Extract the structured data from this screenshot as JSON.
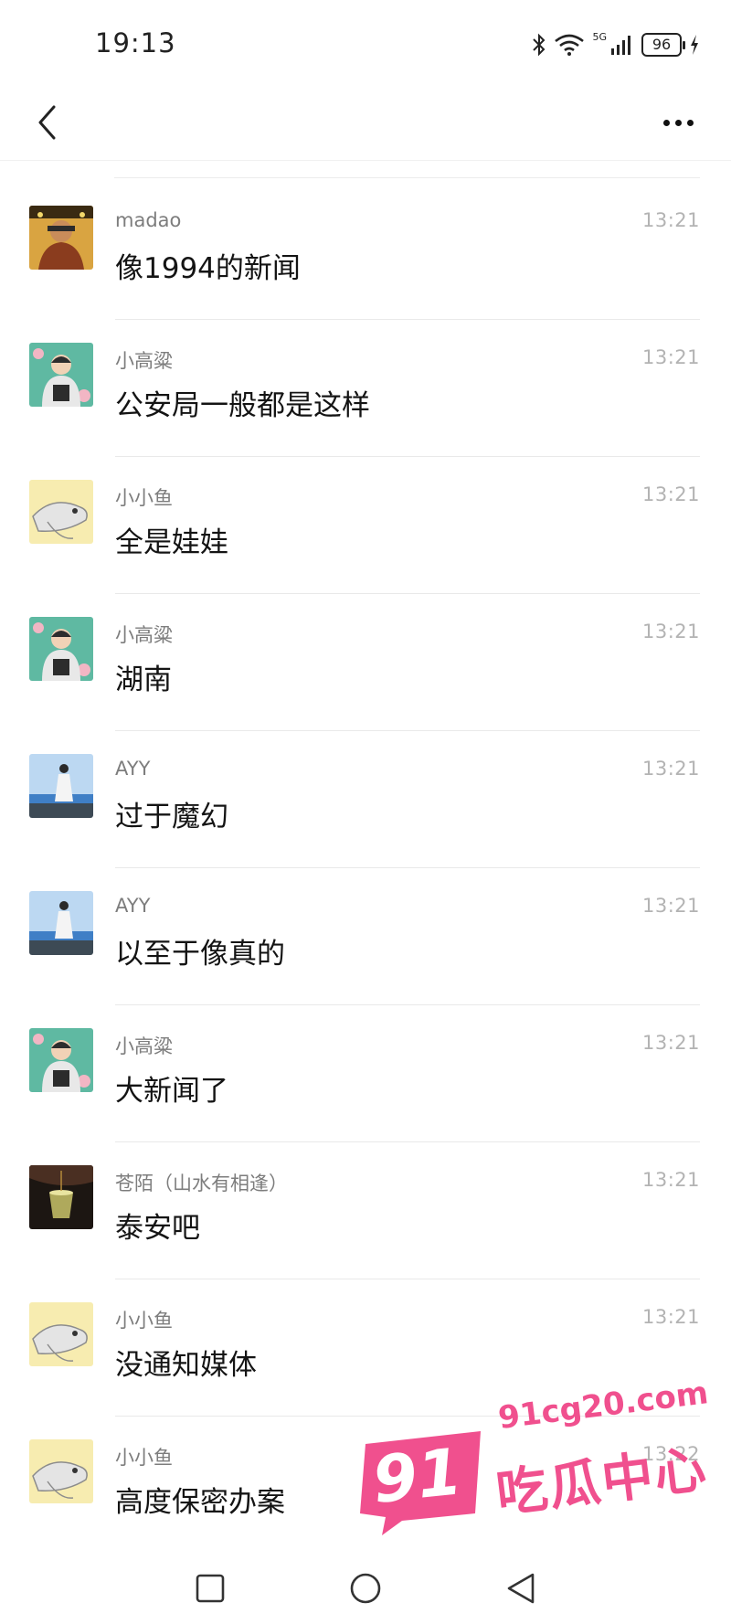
{
  "status": {
    "time": "19:13",
    "network": "5G",
    "battery": "96"
  },
  "messages": [
    {
      "sender": "madao",
      "time": "13:21",
      "text": "像1994的新闻",
      "avatar": "avatar-madao"
    },
    {
      "sender": "小高粱",
      "time": "13:21",
      "text": "公安局一般都是这样",
      "avatar": "avatar-xiaogaoliang"
    },
    {
      "sender": "小小鱼",
      "time": "13:21",
      "text": "全是娃娃",
      "avatar": "avatar-xiaoxiaoyu"
    },
    {
      "sender": "小高粱",
      "time": "13:21",
      "text": "湖南",
      "avatar": "avatar-xiaogaoliang"
    },
    {
      "sender": "AYY",
      "time": "13:21",
      "text": "过于魔幻",
      "avatar": "avatar-ayy"
    },
    {
      "sender": "AYY",
      "time": "13:21",
      "text": "以至于像真的",
      "avatar": "avatar-ayy"
    },
    {
      "sender": "小高粱",
      "time": "13:21",
      "text": "大新闻了",
      "avatar": "avatar-xiaogaoliang"
    },
    {
      "sender": "苍陌（山水有相逢）",
      "time": "13:21",
      "text": "泰安吧",
      "avatar": "avatar-cangmo"
    },
    {
      "sender": "小小鱼",
      "time": "13:21",
      "text": "没通知媒体",
      "avatar": "avatar-xiaoxiaoyu"
    },
    {
      "sender": "小小鱼",
      "time": "13:22",
      "text": "高度保密办案",
      "avatar": "avatar-xiaoxiaoyu"
    }
  ],
  "watermark": {
    "url": "91cg20.com",
    "number": "91",
    "text": "吃瓜中心"
  },
  "colors": {
    "background": "#ffffff",
    "sender_text": "#7d7d7d",
    "time_text": "#b3b3b3",
    "watermark_pink": "#f0508e"
  },
  "icons": {
    "back": "chevron-left-icon",
    "more": "more-dots-icon",
    "bluetooth": "bluetooth-icon",
    "wifi": "wifi-icon",
    "signal": "signal-icon",
    "charging": "charging-bolt-icon",
    "home": "square-home-icon",
    "recent": "circle-icon",
    "sys_back": "triangle-back-icon"
  }
}
